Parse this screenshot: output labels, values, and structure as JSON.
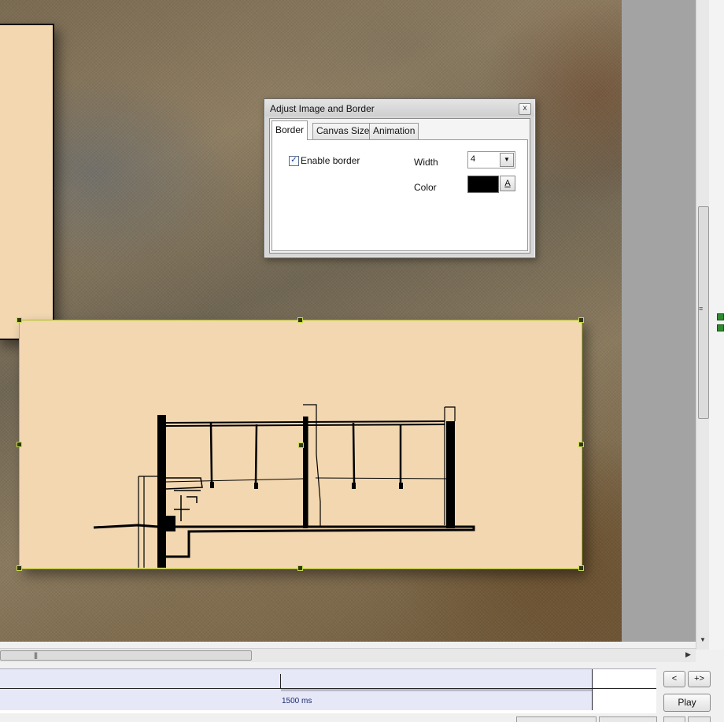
{
  "dialog": {
    "title": "Adjust Image and Border",
    "close_glyph": "x",
    "tabs": [
      {
        "label": "Border",
        "active": true
      },
      {
        "label": "Canvas Size",
        "active": false
      },
      {
        "label": "Animation",
        "active": false
      }
    ],
    "border": {
      "enable_label": "Enable border",
      "enabled": true,
      "width_label": "Width",
      "width_value": "4",
      "color_label": "Color",
      "color_value": "#000000",
      "color_picker_glyph": "A"
    }
  },
  "timeline": {
    "duration_label": "1500 ms"
  },
  "controls": {
    "prev_label": "<",
    "next_label": "+>",
    "play_label": "Play"
  },
  "colors": {
    "image_fill": "#f2d7b0",
    "selection_border": "#a9c21c",
    "timeline_track": "#e6e8f8"
  },
  "icons": [
    "close-icon",
    "checkbox-checked-icon",
    "dropdown-arrow-icon",
    "color-picker-icon",
    "scroll-grip-icon",
    "scroll-right-arrow-icon",
    "scroll-down-arrow-icon"
  ]
}
